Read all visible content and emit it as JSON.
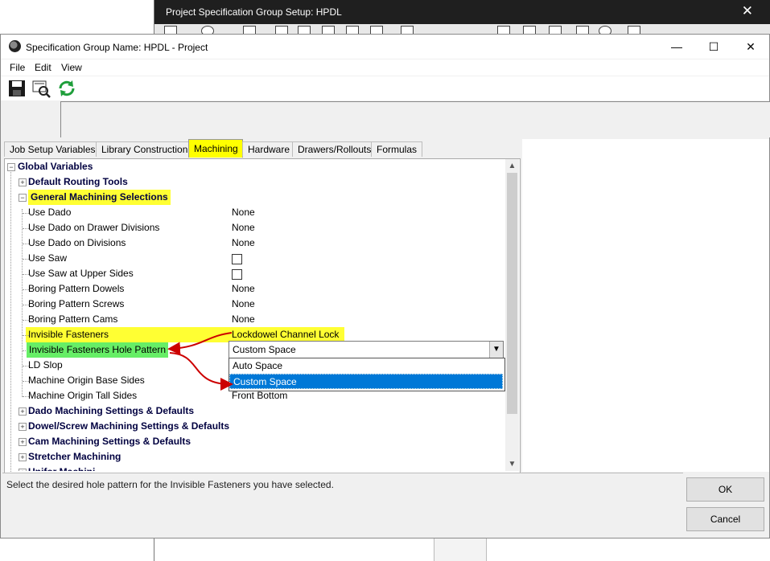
{
  "background_window": {
    "title": "Project Specification Group Setup: HPDL",
    "close": "✕"
  },
  "dialog": {
    "title": "Specification Group Name: HPDL - Project",
    "minimize": "—",
    "maximize": "☐",
    "close": "✕"
  },
  "menu": {
    "file": "File",
    "edit": "Edit",
    "view": "View"
  },
  "toolbar": {
    "icons": [
      "save-icon",
      "print-preview-icon",
      "refresh-icon"
    ]
  },
  "tabs": [
    {
      "label": "Job Setup Variables"
    },
    {
      "label": "Library Construction"
    },
    {
      "label": "Machining"
    },
    {
      "label": "Hardware"
    },
    {
      "label": "Drawers/Rollouts"
    },
    {
      "label": "Formulas"
    }
  ],
  "active_tab": "Machining",
  "tree": {
    "root": "Global Variables",
    "default_routing_tools": "Default Routing Tools",
    "general_machining": "General Machining Selections",
    "items": [
      {
        "label": "Use Dado",
        "value": "None"
      },
      {
        "label": "Use Dado on Drawer Divisions",
        "value": "None"
      },
      {
        "label": "Use Dado on Divisions",
        "value": "None"
      },
      {
        "label": "Use Saw",
        "value": ""
      },
      {
        "label": "Use Saw at Upper Sides",
        "value": ""
      },
      {
        "label": "Boring Pattern Dowels",
        "value": "None"
      },
      {
        "label": "Boring Pattern Screws",
        "value": "None"
      },
      {
        "label": "Boring Pattern Cams",
        "value": "None"
      },
      {
        "label": "Invisible Fasteners",
        "value": "Lockdowel Channel Lock"
      },
      {
        "label": "Invisible Fasteners Hole Pattern",
        "value": "Custom Space"
      },
      {
        "label": "LD Slop",
        "value": ""
      },
      {
        "label": "Machine Origin Base Sides",
        "value": ""
      },
      {
        "label": "Machine Origin Tall Sides",
        "value": "Front Bottom"
      }
    ],
    "groups": [
      "Dado Machining Settings & Defaults",
      "Dowel/Screw Machining Settings & Defaults",
      "Cam Machining Settings & Defaults",
      "Stretcher Machining",
      "Unifor Machini..."
    ]
  },
  "combo": {
    "value": "Custom Space",
    "options": [
      "Auto Space",
      "Custom Space"
    ],
    "selected": "Custom Space"
  },
  "description": "Select the desired hole pattern for the Invisible Fasteners you have selected.",
  "buttons": {
    "ok": "OK",
    "cancel": "Cancel"
  },
  "colors": {
    "highlight_yellow": "#ffff33",
    "highlight_green": "#66ee66",
    "selection_blue": "#0078d7",
    "annotation_arrow": "#cc0000"
  }
}
